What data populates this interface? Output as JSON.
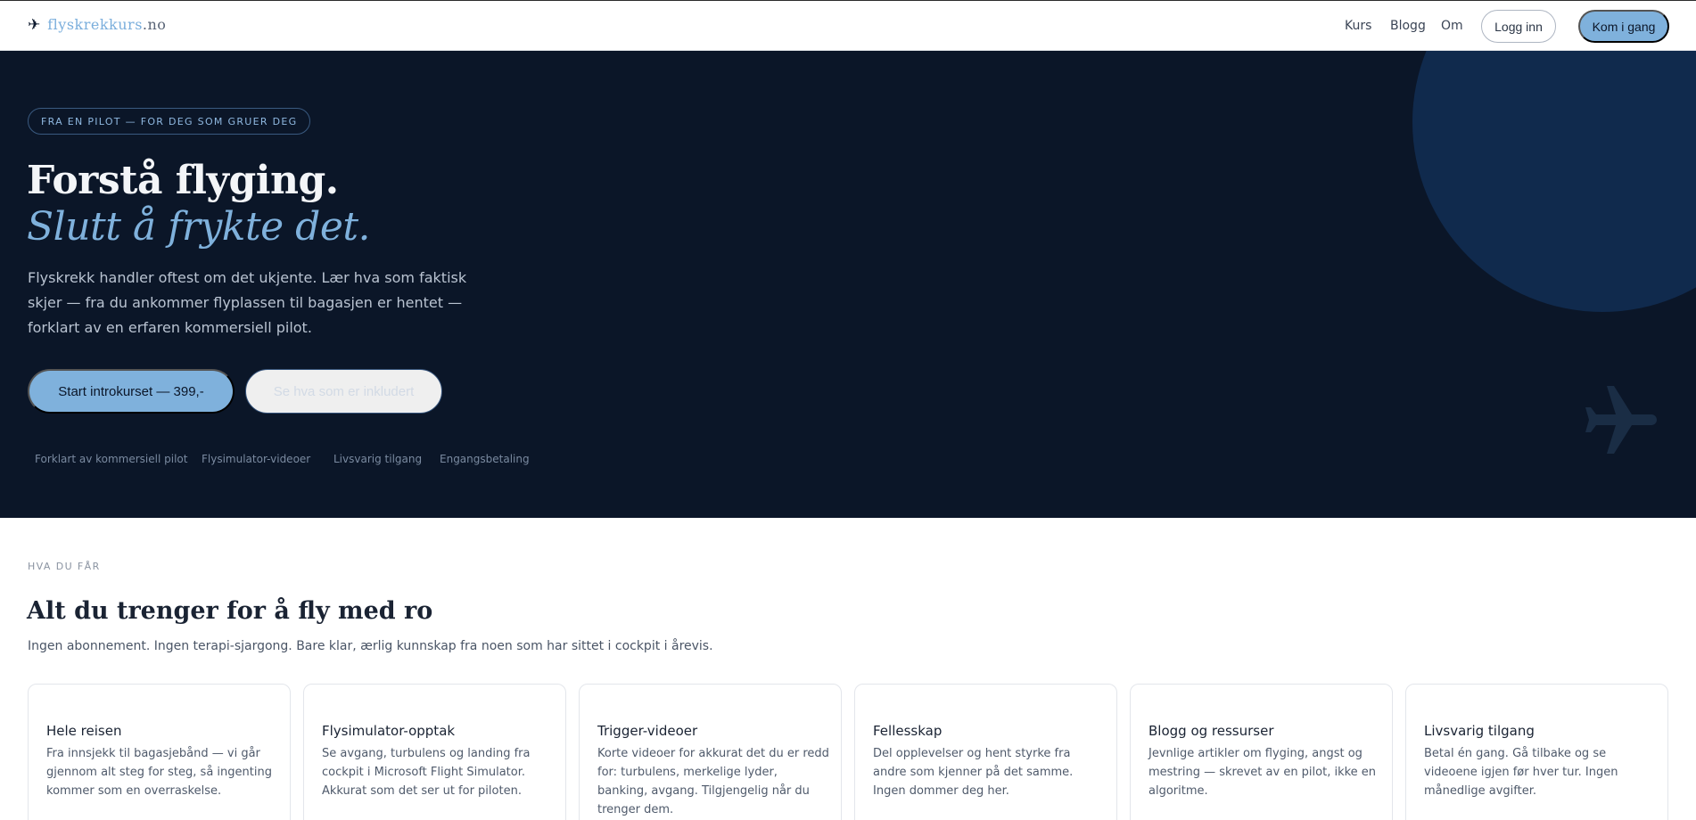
{
  "nav": {
    "logo_brand": "flyskrekkurs",
    "logo_tld": ".no",
    "links": [
      "Kurs",
      "Blogg",
      "Om"
    ],
    "login": "Logg inn",
    "cta": "Kom i gang"
  },
  "hero": {
    "tagline": "FRA EN PILOT — FOR DEG SOM GRUER DEG",
    "title_line1": "Forstå flyging.",
    "title_line2": "Slutt å frykte det.",
    "description": "Flyskrekk handler oftest om det ukjente. Lær hva som faktisk skjer — fra du ankommer flyplassen til bagasjen er hentet — forklart av en erfaren kommersiell pilot.",
    "primary_button": "Start introkurset — 399,-",
    "secondary_button": "Se hva som er inkludert",
    "features": [
      "Forklart av kommersiell pilot",
      "Flysimulator-videoer",
      "Livsvarig tilgang",
      "Engangsbetaling"
    ]
  },
  "section": {
    "eyebrow": "HVA DU FÅR",
    "title": "Alt du trenger for å fly med ro",
    "subtitle": "Ingen abonnement. Ingen terapi-sjargong. Bare klar, ærlig kunnskap fra noen som har sittet i cockpit i årevis.",
    "cards": [
      {
        "title": "Hele reisen",
        "text": "Fra innsjekk til bagasjebånd — vi går gjennom alt steg for steg, så ingenting kommer som en overraskelse."
      },
      {
        "title": "Flysimulator-opptak",
        "text": "Se avgang, turbulens og landing fra cockpit i Microsoft Flight Simulator. Akkurat som det ser ut for piloten."
      },
      {
        "title": "Trigger-videoer",
        "text": "Korte videoer for akkurat det du er redd for: turbulens, merkelige lyder, banking, avgang. Tilgjengelig når du trenger dem."
      },
      {
        "title": "Fellesskap",
        "text": "Del opplevelser og hent styrke fra andre som kjenner på det samme. Ingen dommer deg her."
      },
      {
        "title": "Blogg og ressurser",
        "text": "Jevnlige artikler om flyging, angst og mestring — skrevet av en pilot, ikke en algoritme."
      },
      {
        "title": "Livsvarig tilgang",
        "text": "Betal én gang. Gå tilbake og se videoene igjen før hver tur. Ingen månedlige avgifter."
      }
    ]
  },
  "colors": {
    "hero_bg": "#0b1628",
    "accent": "#7fb1dc",
    "circle": "#102a4d"
  },
  "icons": {
    "logo": "airplane-icon",
    "hero_decoration": "airplane-icon"
  }
}
